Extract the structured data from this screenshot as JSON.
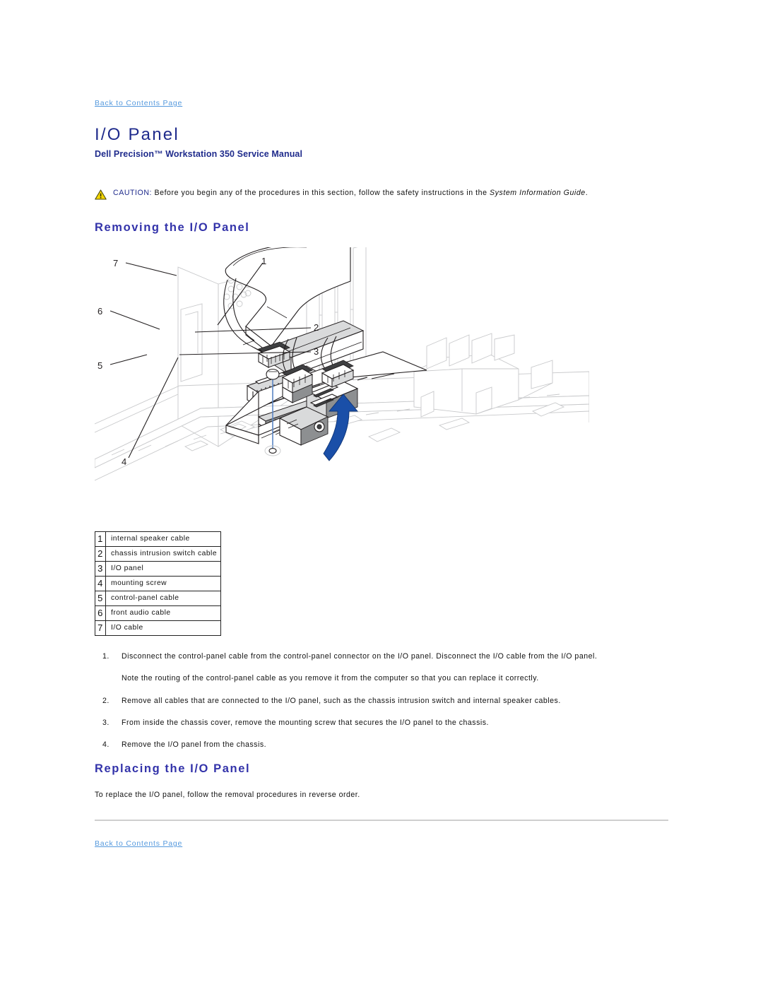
{
  "header": {
    "back_link_top": "Back to Contents Page",
    "title": "I/O Panel",
    "subtitle": "Dell Precision™ Workstation 350 Service Manual"
  },
  "caution": {
    "icon": "warning-triangle-icon",
    "label": "CAUTION:",
    "text_before_italic": " Before you begin any of the procedures in this section, follow the safety instructions in the ",
    "italic_text": "System Information Guide",
    "text_after_italic": ".",
    "icon_color": "#f5d600",
    "label_color": "#1f2b8c"
  },
  "sections": {
    "removing_heading": "Removing the I/O Panel",
    "replacing_heading": "Replacing the I/O Panel",
    "replacing_body": "To replace the I/O panel, follow the removal procedures in reverse order."
  },
  "figure": {
    "alt": "Exploded view of the I/O panel inside the chassis with numbered callouts 1 through 7",
    "callouts": [
      "1",
      "2",
      "3",
      "4",
      "5",
      "6",
      "7"
    ],
    "arrow_color": "#1a4fa8"
  },
  "legend": {
    "rows": [
      {
        "num": "1",
        "label": "internal speaker cable"
      },
      {
        "num": "2",
        "label": "chassis intrusion switch cable"
      },
      {
        "num": "3",
        "label": "I/O panel"
      },
      {
        "num": "4",
        "label": "mounting screw"
      },
      {
        "num": "5",
        "label": "control-panel cable"
      },
      {
        "num": "6",
        "label": "front audio cable"
      },
      {
        "num": "7",
        "label": "I/O cable"
      }
    ]
  },
  "steps": [
    {
      "marker": "1.",
      "text": "Disconnect the control-panel cable from the control-panel connector on the I/O panel. Disconnect the I/O cable from the I/O panel."
    },
    {
      "marker": "2.",
      "text": "Remove all cables that are connected to the I/O panel, such as the chassis intrusion switch and internal speaker cables."
    },
    {
      "marker": "3.",
      "text": "From inside the chassis cover, remove the mounting screw that secures the I/O panel to the chassis."
    },
    {
      "marker": "4.",
      "text": "Remove the I/O panel from the chassis."
    }
  ],
  "note_after_step1": "Note the routing of the control-panel cable as you remove it from the computer so that you can replace it correctly.",
  "footer": {
    "back_link_bottom": "Back to Contents Page"
  },
  "colors": {
    "heading_blue": "#1f2b8c",
    "section_blue": "#3333aa",
    "link_blue": "#5599dd",
    "rule_gray": "#cfcfcf"
  }
}
